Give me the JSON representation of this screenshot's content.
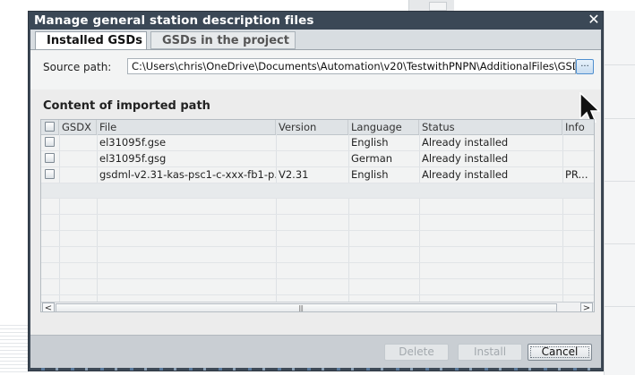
{
  "dialog": {
    "title": "Manage general station description files",
    "close_glyph": "✕"
  },
  "tabs": [
    {
      "label": "Installed GSDs",
      "active": true
    },
    {
      "label": "GSDs in the project",
      "active": false
    }
  ],
  "source": {
    "label": "Source path:",
    "value": "C:\\Users\\chris\\OneDrive\\Documents\\Automation\\v20\\TestwithPNPN\\AdditionalFiles\\GSD",
    "browse_label": "..."
  },
  "content": {
    "title": "Content of imported path",
    "columns": [
      "GSDX",
      "File",
      "Version",
      "Language",
      "Status",
      "Info"
    ],
    "rows": [
      {
        "file": "el31095f.gse",
        "version": "",
        "language": "English",
        "status": "Already installed",
        "info": ""
      },
      {
        "file": "el31095f.gsg",
        "version": "",
        "language": "German",
        "status": "Already installed",
        "info": ""
      },
      {
        "file": "gsdml-v2.31-kas-psc1-c-xxx-fb1-p...",
        "version": "V2.31",
        "language": "English",
        "status": "Already installed",
        "info": "PR..."
      }
    ],
    "scroll_left": "<",
    "scroll_right": ">",
    "scroll_grip": "|||"
  },
  "footer": {
    "delete_label": "Delete",
    "install_label": "Install",
    "cancel_label": "Cancel"
  },
  "colors": {
    "titlebar": "#3b4856",
    "dialog_body": "#d8dde1",
    "accent_button": "#4f8fcf"
  }
}
